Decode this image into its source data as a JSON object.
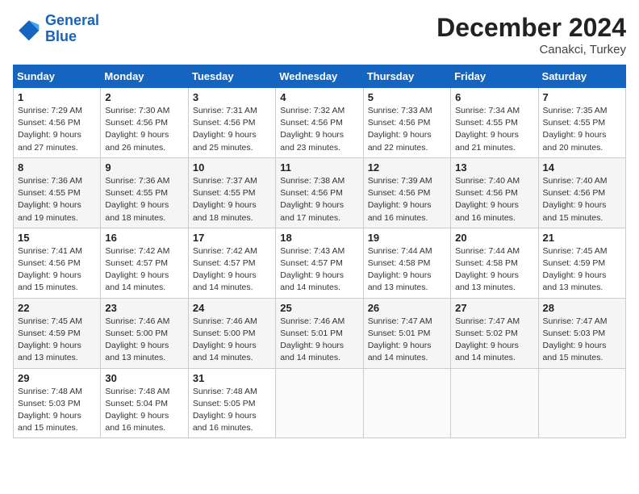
{
  "logo": {
    "line1": "General",
    "line2": "Blue"
  },
  "title": "December 2024",
  "subtitle": "Canakci, Turkey",
  "days_of_week": [
    "Sunday",
    "Monday",
    "Tuesday",
    "Wednesday",
    "Thursday",
    "Friday",
    "Saturday"
  ],
  "weeks": [
    [
      {
        "day": "1",
        "sunrise": "7:29 AM",
        "sunset": "4:56 PM",
        "daylight": "9 hours and 27 minutes."
      },
      {
        "day": "2",
        "sunrise": "7:30 AM",
        "sunset": "4:56 PM",
        "daylight": "9 hours and 26 minutes."
      },
      {
        "day": "3",
        "sunrise": "7:31 AM",
        "sunset": "4:56 PM",
        "daylight": "9 hours and 25 minutes."
      },
      {
        "day": "4",
        "sunrise": "7:32 AM",
        "sunset": "4:56 PM",
        "daylight": "9 hours and 23 minutes."
      },
      {
        "day": "5",
        "sunrise": "7:33 AM",
        "sunset": "4:56 PM",
        "daylight": "9 hours and 22 minutes."
      },
      {
        "day": "6",
        "sunrise": "7:34 AM",
        "sunset": "4:55 PM",
        "daylight": "9 hours and 21 minutes."
      },
      {
        "day": "7",
        "sunrise": "7:35 AM",
        "sunset": "4:55 PM",
        "daylight": "9 hours and 20 minutes."
      }
    ],
    [
      {
        "day": "8",
        "sunrise": "7:36 AM",
        "sunset": "4:55 PM",
        "daylight": "9 hours and 19 minutes."
      },
      {
        "day": "9",
        "sunrise": "7:36 AM",
        "sunset": "4:55 PM",
        "daylight": "9 hours and 18 minutes."
      },
      {
        "day": "10",
        "sunrise": "7:37 AM",
        "sunset": "4:55 PM",
        "daylight": "9 hours and 18 minutes."
      },
      {
        "day": "11",
        "sunrise": "7:38 AM",
        "sunset": "4:56 PM",
        "daylight": "9 hours and 17 minutes."
      },
      {
        "day": "12",
        "sunrise": "7:39 AM",
        "sunset": "4:56 PM",
        "daylight": "9 hours and 16 minutes."
      },
      {
        "day": "13",
        "sunrise": "7:40 AM",
        "sunset": "4:56 PM",
        "daylight": "9 hours and 16 minutes."
      },
      {
        "day": "14",
        "sunrise": "7:40 AM",
        "sunset": "4:56 PM",
        "daylight": "9 hours and 15 minutes."
      }
    ],
    [
      {
        "day": "15",
        "sunrise": "7:41 AM",
        "sunset": "4:56 PM",
        "daylight": "9 hours and 15 minutes."
      },
      {
        "day": "16",
        "sunrise": "7:42 AM",
        "sunset": "4:57 PM",
        "daylight": "9 hours and 14 minutes."
      },
      {
        "day": "17",
        "sunrise": "7:42 AM",
        "sunset": "4:57 PM",
        "daylight": "9 hours and 14 minutes."
      },
      {
        "day": "18",
        "sunrise": "7:43 AM",
        "sunset": "4:57 PM",
        "daylight": "9 hours and 14 minutes."
      },
      {
        "day": "19",
        "sunrise": "7:44 AM",
        "sunset": "4:58 PM",
        "daylight": "9 hours and 13 minutes."
      },
      {
        "day": "20",
        "sunrise": "7:44 AM",
        "sunset": "4:58 PM",
        "daylight": "9 hours and 13 minutes."
      },
      {
        "day": "21",
        "sunrise": "7:45 AM",
        "sunset": "4:59 PM",
        "daylight": "9 hours and 13 minutes."
      }
    ],
    [
      {
        "day": "22",
        "sunrise": "7:45 AM",
        "sunset": "4:59 PM",
        "daylight": "9 hours and 13 minutes."
      },
      {
        "day": "23",
        "sunrise": "7:46 AM",
        "sunset": "5:00 PM",
        "daylight": "9 hours and 13 minutes."
      },
      {
        "day": "24",
        "sunrise": "7:46 AM",
        "sunset": "5:00 PM",
        "daylight": "9 hours and 14 minutes."
      },
      {
        "day": "25",
        "sunrise": "7:46 AM",
        "sunset": "5:01 PM",
        "daylight": "9 hours and 14 minutes."
      },
      {
        "day": "26",
        "sunrise": "7:47 AM",
        "sunset": "5:01 PM",
        "daylight": "9 hours and 14 minutes."
      },
      {
        "day": "27",
        "sunrise": "7:47 AM",
        "sunset": "5:02 PM",
        "daylight": "9 hours and 14 minutes."
      },
      {
        "day": "28",
        "sunrise": "7:47 AM",
        "sunset": "5:03 PM",
        "daylight": "9 hours and 15 minutes."
      }
    ],
    [
      {
        "day": "29",
        "sunrise": "7:48 AM",
        "sunset": "5:03 PM",
        "daylight": "9 hours and 15 minutes."
      },
      {
        "day": "30",
        "sunrise": "7:48 AM",
        "sunset": "5:04 PM",
        "daylight": "9 hours and 16 minutes."
      },
      {
        "day": "31",
        "sunrise": "7:48 AM",
        "sunset": "5:05 PM",
        "daylight": "9 hours and 16 minutes."
      },
      null,
      null,
      null,
      null
    ]
  ]
}
